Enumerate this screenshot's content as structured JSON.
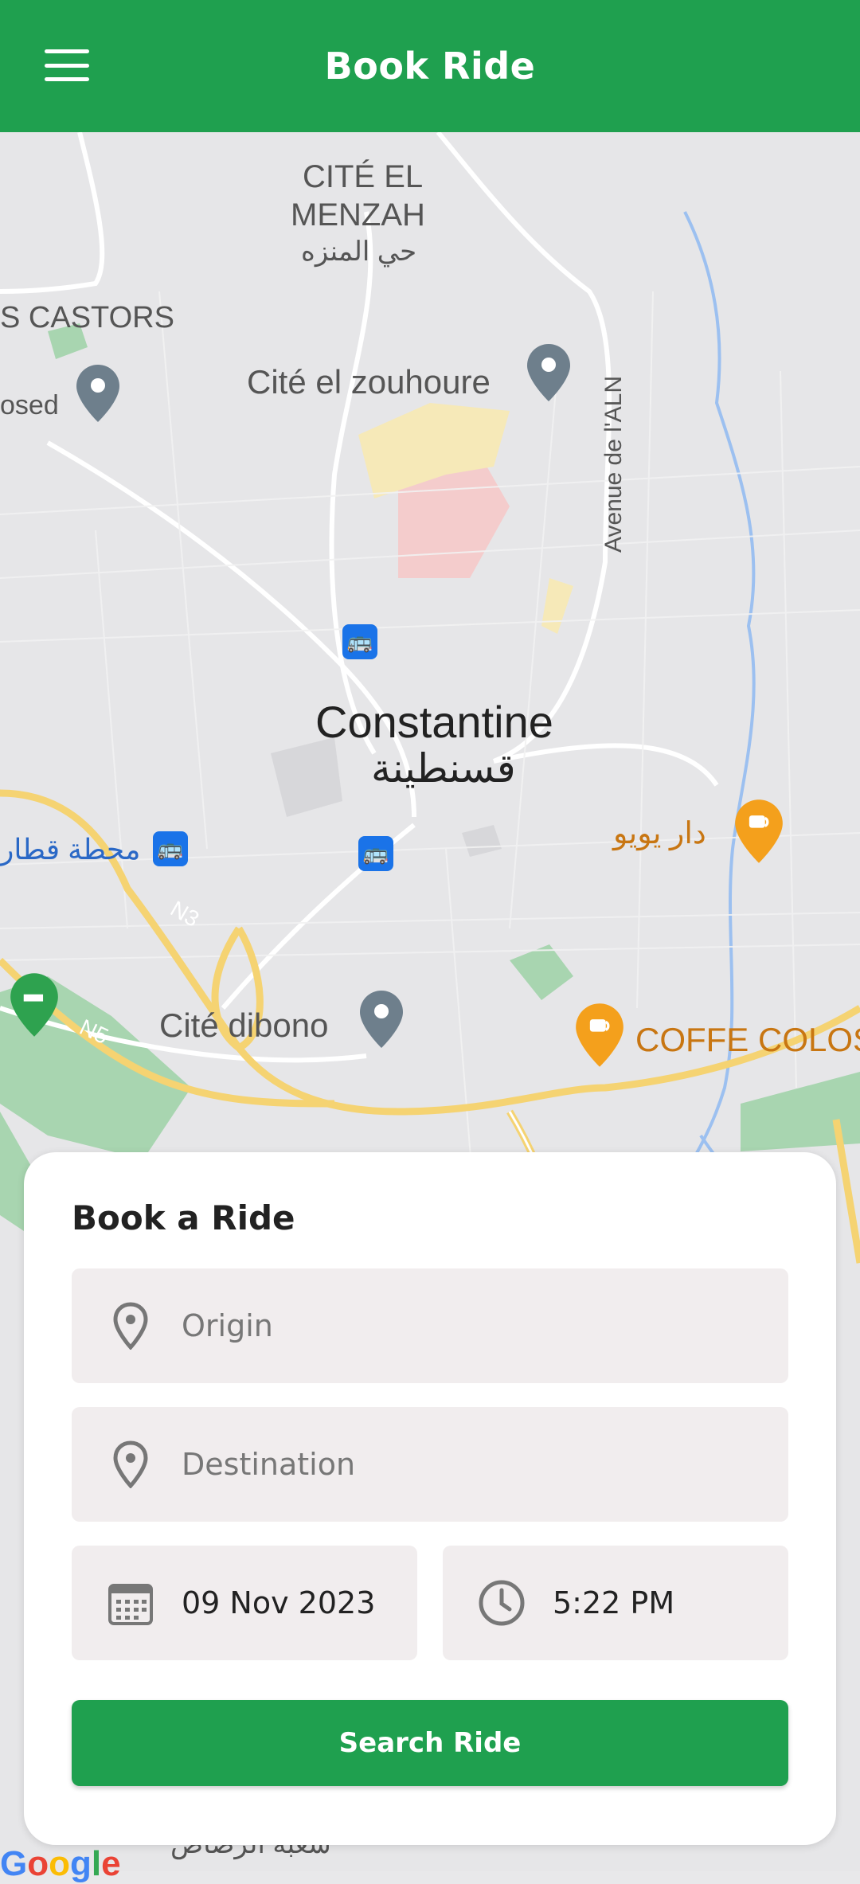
{
  "appbar": {
    "title": "Book Ride",
    "menu_icon": "hamburger-menu-icon"
  },
  "map": {
    "labels": {
      "cite_el": "CITÉ EL",
      "menzah": "MENZAH",
      "menzah_ar": "حي المنزه",
      "castors": "S CASTORS",
      "closed": "osed",
      "zouhoure": "Cité el zouhoure",
      "avenue": "Avenue de l'ALN",
      "city": "Constantine",
      "city_ar": "قسنطينة",
      "station_ar": "محطة قطار",
      "dar_yoyo": "دار يويو",
      "n3_road": "N3",
      "n5_road": "N5",
      "dibono": "Cité dibono",
      "coffe": "COFFE COLOS",
      "n3_badge": "N3",
      "bottom_ar": "شعبة الرصاص",
      "google": "Google"
    },
    "colors": {
      "road_major": "#f5d372",
      "water": "#9cc0f0",
      "park": "#a8d5b0",
      "pin": "#6e7f8c",
      "cafe": "#f4a01c"
    }
  },
  "booking": {
    "title": "Book a Ride",
    "origin_placeholder": "Origin",
    "destination_placeholder": "Destination",
    "date_value": "09 Nov 2023",
    "time_value": "5:22 PM",
    "search_label": "Search Ride",
    "icons": {
      "origin": "location-pin-icon",
      "destination": "location-pin-icon",
      "date": "calendar-icon",
      "time": "clock-icon"
    }
  },
  "theme": {
    "primary": "#1fa04f",
    "field_bg": "#f1edee"
  }
}
